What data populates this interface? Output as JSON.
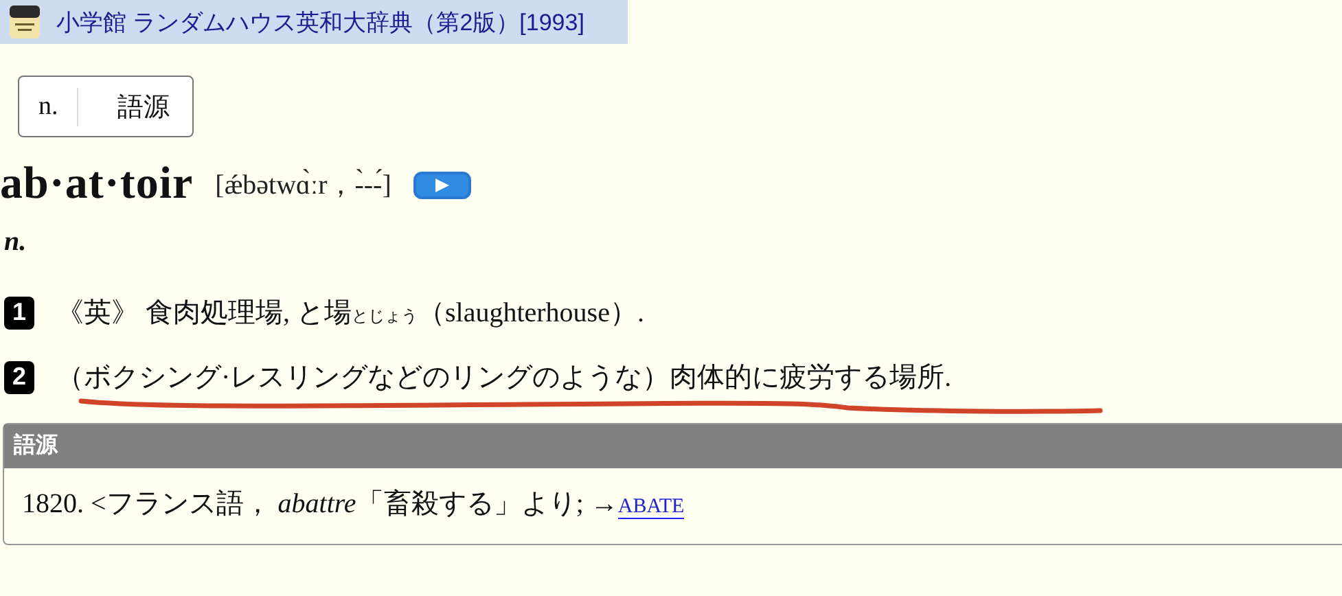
{
  "header": {
    "title": "小学館 ランダムハウス英和大辞典（第2版）[1993]"
  },
  "jump_tabs": [
    {
      "label": "n."
    },
    {
      "label": "語源"
    }
  ],
  "entry": {
    "headword": "ab·at·toir",
    "pronunciation": "[ǽbətwɑ̀ːr，-̀--́]",
    "part_of_speech": "n."
  },
  "senses": [
    {
      "number": "1",
      "text": "《英》 食肉処理場, と場$_{とじょう}$（slaughterhouse）."
    },
    {
      "number": "2",
      "text": "（ボクシング·レスリングなどのリングのような）肉体的に疲労する場所."
    }
  ],
  "etymology": {
    "heading": "語源",
    "text": "1820. <フランス語， *abattre*「畜殺する」より; →",
    "link": "ABATE"
  }
}
